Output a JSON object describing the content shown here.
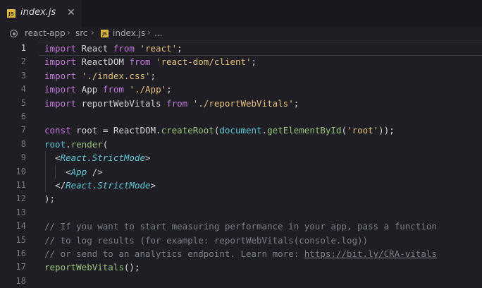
{
  "tab": {
    "icon": "JS",
    "name": "index.js",
    "close": "✕"
  },
  "breadcrumb": {
    "items": [
      "react-app",
      "src",
      "index.js",
      "..."
    ],
    "sep": "›",
    "js_icon": "JS"
  },
  "editor": {
    "line_numbers": [
      "1",
      "2",
      "3",
      "4",
      "5",
      "6",
      "7",
      "8",
      "9",
      "10",
      "11",
      "12",
      "13",
      "14",
      "15",
      "16",
      "17",
      "18"
    ],
    "active_line": 1,
    "lines": [
      [
        {
          "t": "import",
          "c": "kw"
        },
        {
          "t": " React ",
          "c": ""
        },
        {
          "t": "from",
          "c": "kw"
        },
        {
          "t": " ",
          "c": ""
        },
        {
          "t": "'react'",
          "c": "str"
        },
        {
          "t": ";",
          "c": ""
        }
      ],
      [
        {
          "t": "import",
          "c": "kw"
        },
        {
          "t": " ReactDOM ",
          "c": ""
        },
        {
          "t": "from",
          "c": "kw"
        },
        {
          "t": " ",
          "c": ""
        },
        {
          "t": "'react-dom/client'",
          "c": "str"
        },
        {
          "t": ";",
          "c": ""
        }
      ],
      [
        {
          "t": "import",
          "c": "kw"
        },
        {
          "t": " ",
          "c": ""
        },
        {
          "t": "'./index.css'",
          "c": "str"
        },
        {
          "t": ";",
          "c": ""
        }
      ],
      [
        {
          "t": "import",
          "c": "kw"
        },
        {
          "t": " App ",
          "c": ""
        },
        {
          "t": "from",
          "c": "kw"
        },
        {
          "t": " ",
          "c": ""
        },
        {
          "t": "'./App'",
          "c": "str"
        },
        {
          "t": ";",
          "c": ""
        }
      ],
      [
        {
          "t": "import",
          "c": "kw"
        },
        {
          "t": " reportWebVitals ",
          "c": ""
        },
        {
          "t": "from",
          "c": "kw"
        },
        {
          "t": " ",
          "c": ""
        },
        {
          "t": "'./reportWebVitals'",
          "c": "str"
        },
        {
          "t": ";",
          "c": ""
        }
      ],
      [],
      [
        {
          "t": "const",
          "c": "kw"
        },
        {
          "t": " root = ReactDOM.",
          "c": ""
        },
        {
          "t": "createRoot",
          "c": "fn"
        },
        {
          "t": "(",
          "c": ""
        },
        {
          "t": "document",
          "c": "var"
        },
        {
          "t": ".",
          "c": ""
        },
        {
          "t": "getElementById",
          "c": "fn"
        },
        {
          "t": "(",
          "c": ""
        },
        {
          "t": "'root'",
          "c": "str"
        },
        {
          "t": "));",
          "c": ""
        }
      ],
      [
        {
          "t": "root",
          "c": "var"
        },
        {
          "t": ".",
          "c": ""
        },
        {
          "t": "render",
          "c": "fn"
        },
        {
          "t": "(",
          "c": ""
        }
      ],
      [
        {
          "t": "  <",
          "c": ""
        },
        {
          "t": "React.StrictMode",
          "c": "tag"
        },
        {
          "t": ">",
          "c": ""
        }
      ],
      [
        {
          "t": "    <",
          "c": ""
        },
        {
          "t": "App",
          "c": "tag"
        },
        {
          "t": " />",
          "c": ""
        }
      ],
      [
        {
          "t": "  </",
          "c": ""
        },
        {
          "t": "React.StrictMode",
          "c": "tag"
        },
        {
          "t": ">",
          "c": ""
        }
      ],
      [
        {
          "t": ");",
          "c": ""
        }
      ],
      [],
      [
        {
          "t": "// If you want to start measuring performance in your app, pass a function",
          "c": "cmt"
        }
      ],
      [
        {
          "t": "// to log results (for example: reportWebVitals(console.log))",
          "c": "cmt"
        }
      ],
      [
        {
          "t": "// or send to an analytics endpoint. Learn more: ",
          "c": "cmt"
        },
        {
          "t": "https://bit.ly/CRA-vitals",
          "c": "link"
        }
      ],
      [
        {
          "t": "reportWebVitals",
          "c": "fn"
        },
        {
          "t": "();",
          "c": ""
        }
      ],
      []
    ]
  }
}
